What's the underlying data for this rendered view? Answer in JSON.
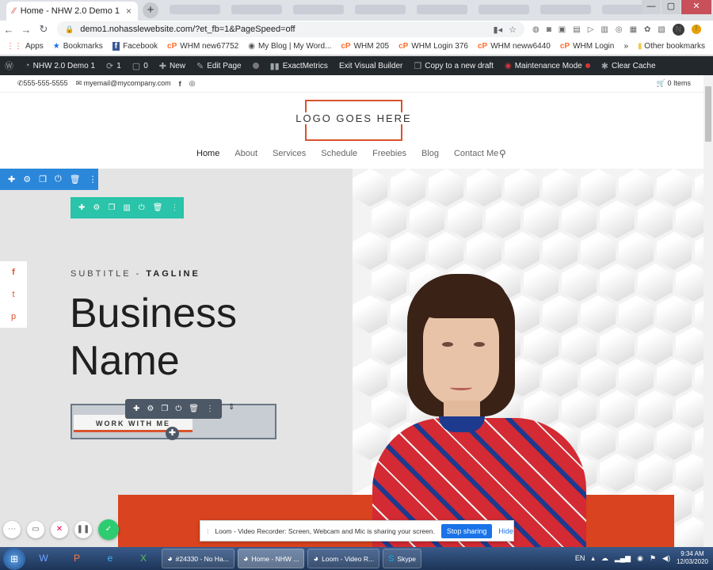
{
  "browser": {
    "tab_title": "Home - NHW 2.0 Demo 1",
    "tab_close": "×",
    "new_tab": "+",
    "window_controls": [
      "—",
      "▢",
      "✕"
    ],
    "url": "demo1.nohasslewebsite.com/?et_fb=1&PageSpeed=off",
    "nav_back": "←",
    "nav_forward": "→",
    "nav_reload": "↻",
    "profile_initial": "N",
    "alert_badge": "!"
  },
  "bookmarks": [
    {
      "icon": "apps-grid-icon",
      "glyph": "⋮⋮",
      "label": "Apps"
    },
    {
      "icon": "star-icon",
      "glyph": "★",
      "label": "Bookmarks"
    },
    {
      "icon": "facebook-icon",
      "glyph": "f",
      "label": "Facebook"
    },
    {
      "icon": "cpanel-icon",
      "glyph": "cP",
      "label": "WHM new67752"
    },
    {
      "icon": "globe-icon",
      "glyph": "◉",
      "label": "My Blog | My Word..."
    },
    {
      "icon": "cpanel-icon",
      "glyph": "cP",
      "label": "WHM 205"
    },
    {
      "icon": "cpanel-icon",
      "glyph": "cP",
      "label": "WHM Login 376"
    },
    {
      "icon": "cpanel-icon",
      "glyph": "cP",
      "label": "WHM neww6440"
    },
    {
      "icon": "cpanel-icon",
      "glyph": "cP",
      "label": "WHM Login"
    }
  ],
  "bookmarks_more": "»",
  "bookmarks_other": "Other bookmarks",
  "wp_admin": {
    "site_name": "NHW 2.0 Demo 1",
    "updates_count": "1",
    "comments_count": "0",
    "new_label": "New",
    "edit_page": "Edit Page",
    "exactmetrics": "ExactMetrics",
    "exit_builder": "Exit Visual Builder",
    "copy_draft": "Copy to a new draft",
    "maintenance": "Maintenance Mode",
    "clear_cache": "Clear Cache"
  },
  "site_topbar": {
    "phone": "555-555-5555",
    "email": "myemail@mycompany.com",
    "cart": "0 Items"
  },
  "logo_text": "LOGO GOES HERE",
  "nav": [
    "Home",
    "About",
    "Services",
    "Schedule",
    "Freebies",
    "Blog",
    "Contact Me"
  ],
  "hero": {
    "subtitle_a": "SUBTITLE - ",
    "subtitle_b": "TAGLINE",
    "business_line1": "Business",
    "business_line2": "Name",
    "cta": "WORK WITH ME"
  },
  "social": [
    "f",
    "t",
    "p"
  ],
  "builder_icons": [
    "✚",
    "⚙",
    "❐",
    "⏻",
    "🗑",
    "⋮"
  ],
  "module_icons": [
    "✚",
    "⚙",
    "❐",
    "▥",
    "⏻",
    "🗑",
    "⋮"
  ],
  "loom": {
    "message": "Loom - Video Recorder: Screen, Webcam and Mic is sharing your screen.",
    "stop": "Stop sharing",
    "hide": "Hide",
    "controls": [
      "⋯",
      "▭",
      "✕",
      "❚❚",
      "✓"
    ]
  },
  "taskbar": {
    "tasks": [
      {
        "label": "#24330 - No Ha...",
        "active": false
      },
      {
        "label": "Home - NHW ...",
        "active": true
      },
      {
        "label": "Loom - Video R...",
        "active": false
      },
      {
        "label": "Skype",
        "active": false
      }
    ],
    "lang": "EN",
    "time": "9:34 AM",
    "date": "12/03/2020"
  }
}
